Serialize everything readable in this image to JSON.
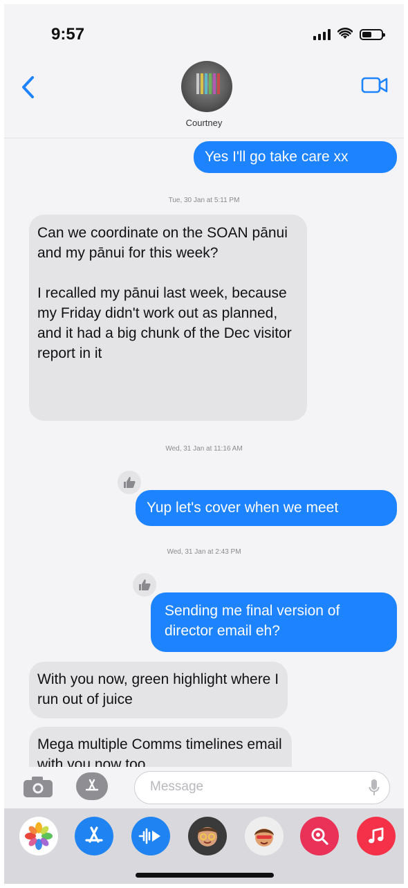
{
  "status": {
    "time": "9:57",
    "battery_level": 0.5
  },
  "header": {
    "contact_name": "Courtney",
    "icons": [
      "chevron-left-icon",
      "video-camera-icon"
    ]
  },
  "messages": [
    {
      "kind": "outgoing",
      "text": "Yes I'll go take care xx"
    },
    {
      "kind": "timestamp",
      "text": "Tue, 30 Jan at 5:11 PM"
    },
    {
      "kind": "incoming",
      "text": "Can we coordinate on the SOAN pānui and my pānui for this week?\n\nI recalled my pānui last week, because my Friday didn't work out as planned, and it had a big chunk of the Dec visitor report in it"
    },
    {
      "kind": "timestamp",
      "text": "Wed, 31 Jan at 11:16 AM"
    },
    {
      "kind": "outgoing",
      "text": "Yup let's cover when we meet",
      "tapback": "thumbs-up-icon"
    },
    {
      "kind": "timestamp",
      "text": "Wed, 31 Jan at 2:43 PM"
    },
    {
      "kind": "outgoing",
      "text": "Sending me final version of director email eh?",
      "tapback": "thumbs-up-icon"
    },
    {
      "kind": "incoming",
      "text": "With you now, green highlight where I run out of juice"
    },
    {
      "kind": "incoming",
      "text": "Mega multiple Comms timelines email with you now too"
    }
  ],
  "input": {
    "placeholder": "Message",
    "value": ""
  },
  "app_drawer": [
    "photos-icon",
    "app-store-icon",
    "audio-message-icon",
    "memoji-icon",
    "memoji-stickers-icon",
    "web-search-icon",
    "music-icon"
  ],
  "colors": {
    "outgoing_bubble": "#1d83ff",
    "incoming_bubble": "#e4e4e7",
    "accent": "#1d83ff"
  }
}
